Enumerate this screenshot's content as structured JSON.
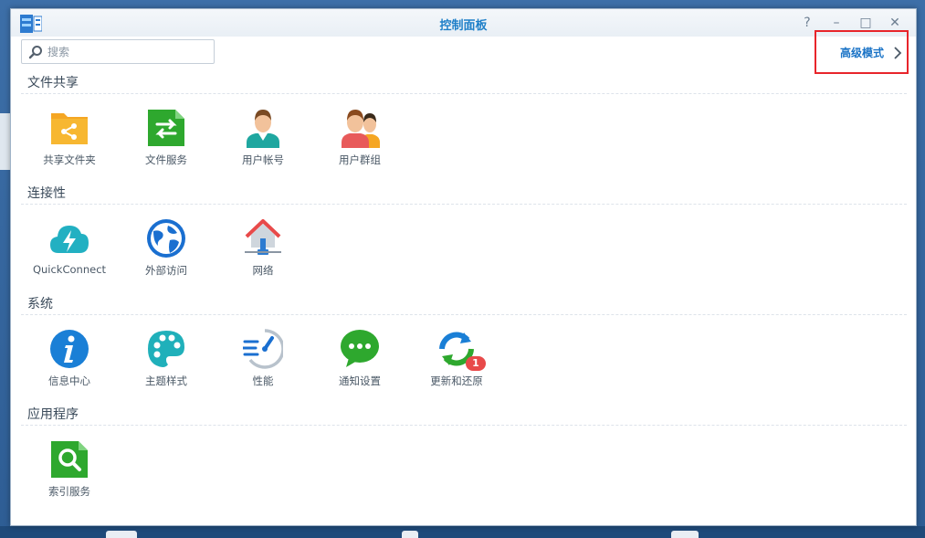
{
  "window": {
    "title": "控制面板",
    "controls": {
      "help": "?",
      "minimize": "–",
      "maximize": "□",
      "close": "✕"
    }
  },
  "search": {
    "placeholder": "搜索",
    "value": ""
  },
  "advanced_mode": {
    "label": "高级模式"
  },
  "sections": [
    {
      "title": "文件共享",
      "items": [
        {
          "label": "共享文件夹",
          "icon": "shared-folder-icon"
        },
        {
          "label": "文件服务",
          "icon": "file-services-icon"
        },
        {
          "label": "用户帐号",
          "icon": "user-icon"
        },
        {
          "label": "用户群组",
          "icon": "group-icon"
        }
      ]
    },
    {
      "title": "连接性",
      "items": [
        {
          "label": "QuickConnect",
          "icon": "quickconnect-cloud-icon"
        },
        {
          "label": "外部访问",
          "icon": "globe-icon"
        },
        {
          "label": "网络",
          "icon": "network-house-icon"
        }
      ]
    },
    {
      "title": "系统",
      "items": [
        {
          "label": "信息中心",
          "icon": "info-icon"
        },
        {
          "label": "主题样式",
          "icon": "palette-icon"
        },
        {
          "label": "性能",
          "icon": "performance-gauge-icon"
        },
        {
          "label": "通知设置",
          "icon": "chat-bubble-icon"
        },
        {
          "label": "更新和还原",
          "icon": "update-restore-icon",
          "badge": "1"
        }
      ]
    },
    {
      "title": "应用程序",
      "items": [
        {
          "label": "索引服务",
          "icon": "index-search-icon"
        }
      ]
    }
  ],
  "colors": {
    "accent": "#1e7fc8",
    "highlight_border": "#e8252b",
    "badge": "#e84a4a"
  }
}
